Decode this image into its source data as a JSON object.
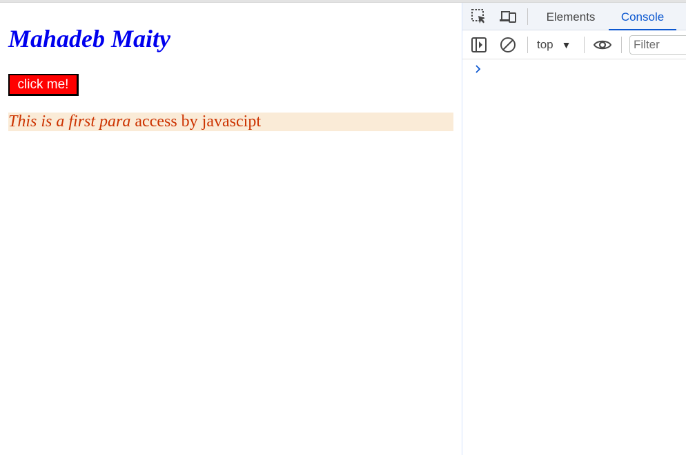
{
  "page": {
    "heading": "Mahadeb Maity",
    "button_label": "click me!",
    "paragraph": {
      "italic_part": "This is a first para",
      "rest": " access by javascipt"
    },
    "colors": {
      "heading": "#0000ee",
      "button_bg": "#ff0000",
      "paragraph_bg": "#faebd7",
      "paragraph_text": "#cc3300"
    }
  },
  "devtools": {
    "tabs": [
      {
        "label": "Elements",
        "active": false
      },
      {
        "label": "Console",
        "active": true
      }
    ],
    "toolbar": {
      "context": "top",
      "filter_placeholder": "Filter"
    },
    "icons": [
      "inspect-element-icon",
      "device-toggle-icon",
      "sidebar-toggle-icon",
      "clear-console-icon",
      "context-dropdown-icon",
      "live-expression-eye-icon",
      "console-prompt-chevron-icon"
    ],
    "accent_color": "#0b57d0"
  }
}
